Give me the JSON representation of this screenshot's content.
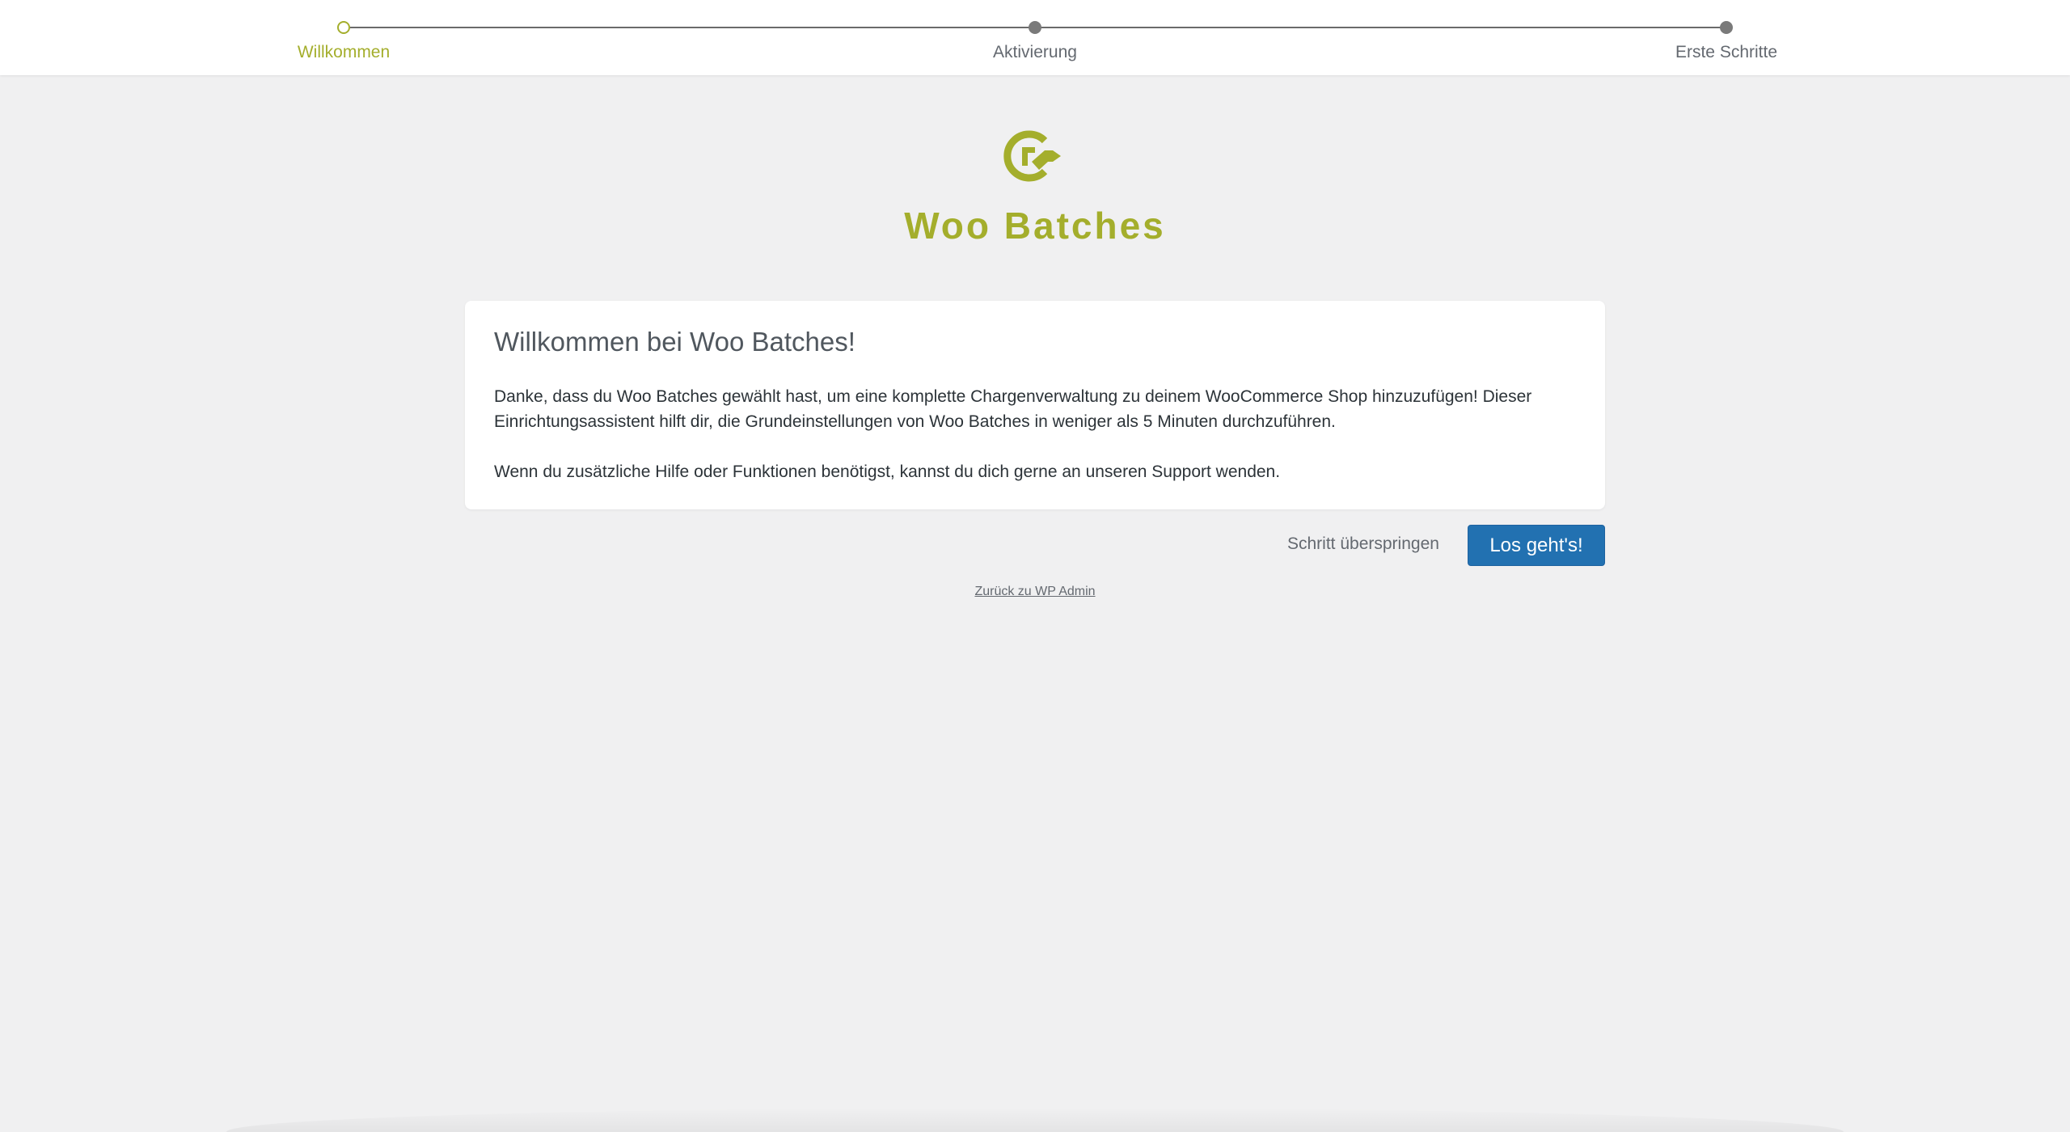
{
  "stepper": {
    "steps": [
      {
        "label": "Willkommen",
        "state": "active"
      },
      {
        "label": "Aktivierung",
        "state": "todo"
      },
      {
        "label": "Erste Schritte",
        "state": "todo"
      }
    ],
    "active_color": "#a4ae2c",
    "inactive_color": "#7a7a7a"
  },
  "brand": {
    "icon": "woo-batches-logo-icon",
    "name": "Woo Batches",
    "color": "#a4ae2c"
  },
  "card": {
    "title": "Willkommen bei Woo Batches!",
    "paragraph1": "Danke, dass du Woo Batches gewählt hast, um eine komplette Chargenverwaltung zu deinem WooCommerce Shop hinzuzufügen! Dieser Einrichtungsassistent hilft dir, die Grundeinstellungen von Woo Batches in weniger als 5 Minuten durchzuführen.",
    "paragraph2": "Wenn du zusätzliche Hilfe oder Funktionen benötigst, kannst du dich gerne an unseren Support wenden."
  },
  "actions": {
    "skip_label": "Schritt überspringen",
    "primary_label": "Los geht's!",
    "primary_color": "#2271b1",
    "back_label": "Zurück zu WP Admin"
  }
}
